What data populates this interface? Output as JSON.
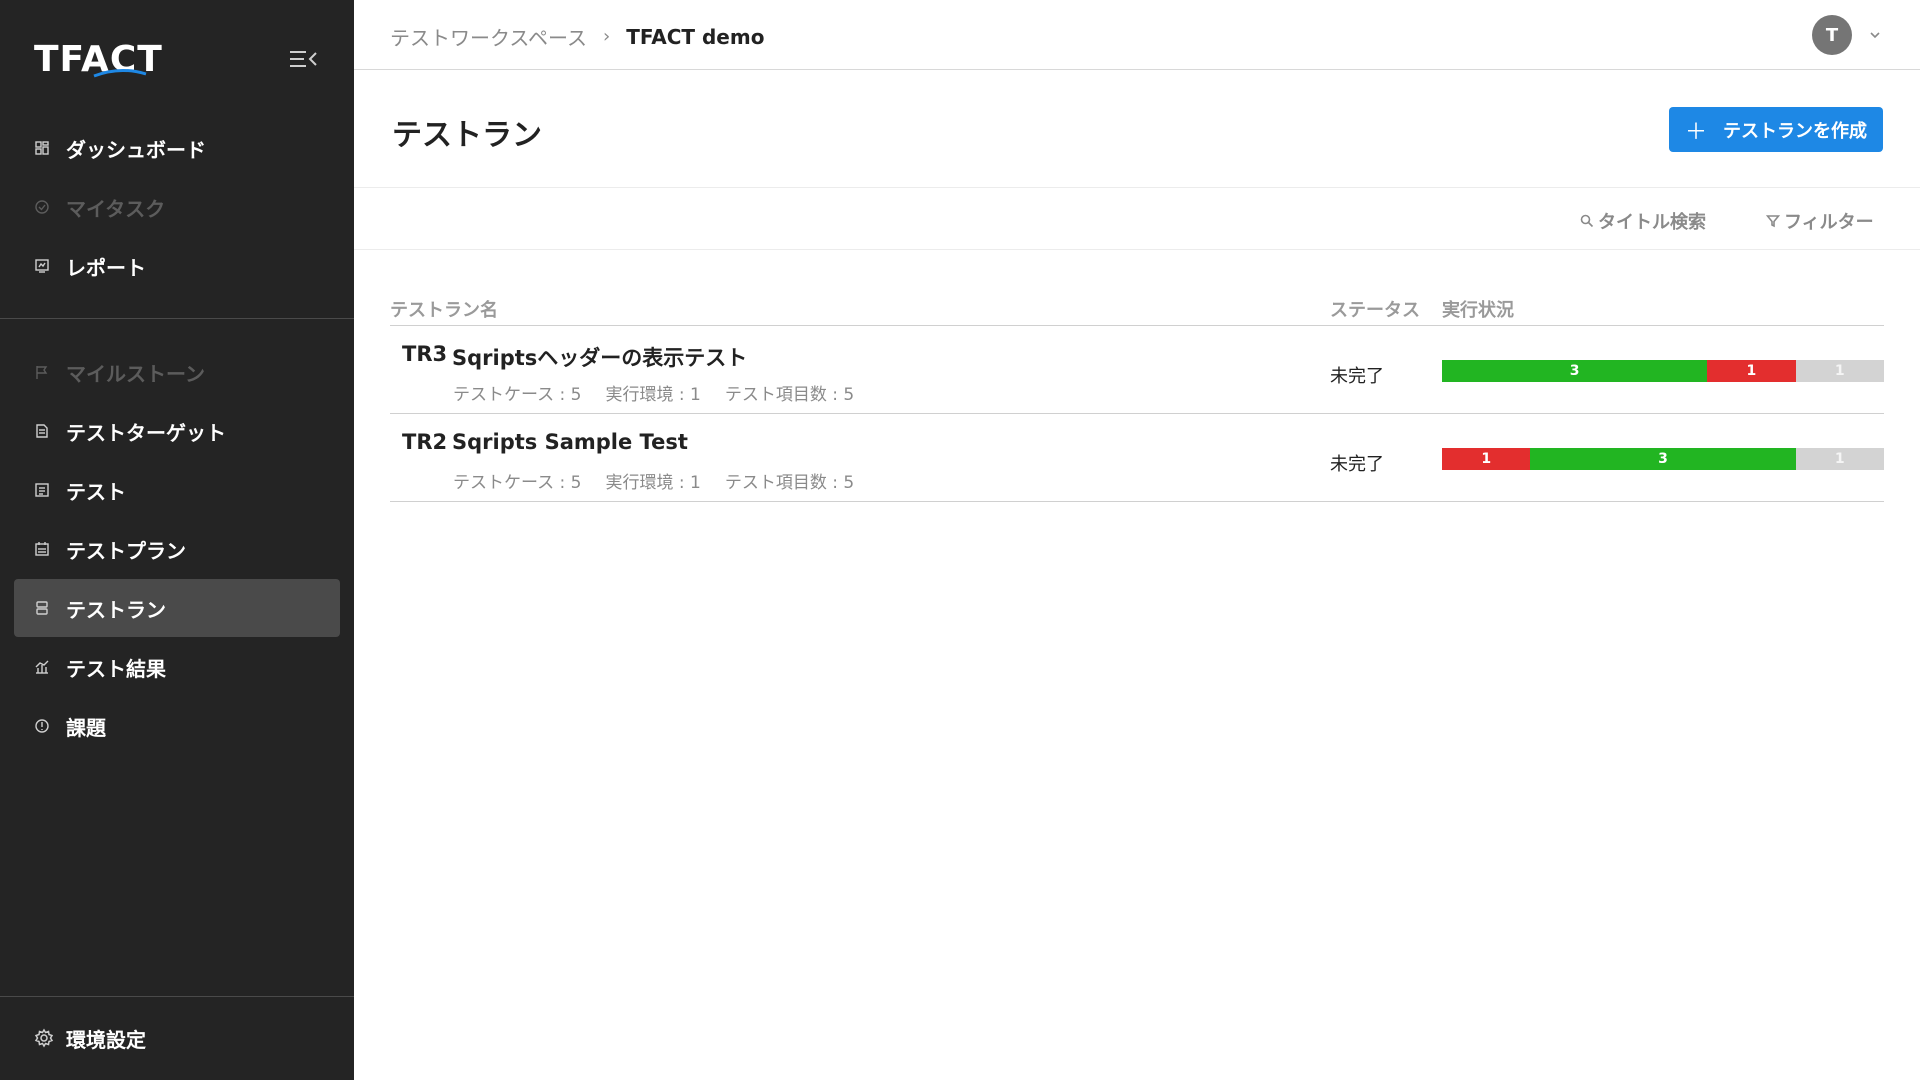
{
  "app": {
    "logo_text": "TFACT"
  },
  "sidebar": {
    "group1": [
      {
        "label": "ダッシュボード",
        "icon": "dashboard-icon",
        "disabled": false
      },
      {
        "label": "マイタスク",
        "icon": "check-circle-icon",
        "disabled": true
      },
      {
        "label": "レポート",
        "icon": "report-icon",
        "disabled": false
      }
    ],
    "group2": [
      {
        "label": "マイルストーン",
        "icon": "flag-icon",
        "disabled": true
      },
      {
        "label": "テストターゲット",
        "icon": "document-icon",
        "disabled": false
      },
      {
        "label": "テスト",
        "icon": "list-icon",
        "disabled": false
      },
      {
        "label": "テストプラン",
        "icon": "calendar-icon",
        "disabled": false
      },
      {
        "label": "テストラン",
        "icon": "database-icon",
        "disabled": false,
        "active": true
      },
      {
        "label": "テスト結果",
        "icon": "chart-icon",
        "disabled": false
      },
      {
        "label": "課題",
        "icon": "alert-icon",
        "disabled": false
      }
    ],
    "settings_label": "環境設定"
  },
  "header": {
    "breadcrumb_parent": "テストワークスペース",
    "breadcrumb_sep": "›",
    "breadcrumb_current": "TFACT demo",
    "avatar_initial": "T"
  },
  "page": {
    "title": "テストラン",
    "create_button_plus": "＋",
    "create_button_label": "テストランを作成"
  },
  "toolbar": {
    "search_label": "タイトル検索",
    "filter_label": "フィルター"
  },
  "table": {
    "headers": {
      "name": "テストラン名",
      "status": "ステータス",
      "progress": "実行状況"
    },
    "rows": [
      {
        "id": "TR3",
        "title": "Sqriptsヘッダーの表示テスト",
        "meta": [
          "テストケース : 5",
          "実行環境 : 1",
          "テスト項目数 : 5"
        ],
        "status": "未完了",
        "segments": [
          {
            "kind": "pass",
            "value": 3
          },
          {
            "kind": "fail",
            "value": 1
          },
          {
            "kind": "none",
            "value": 1
          }
        ]
      },
      {
        "id": "TR2",
        "title": "Sqripts Sample Test",
        "meta": [
          "テストケース : 5",
          "実行環境 : 1",
          "テスト項目数 : 5"
        ],
        "status": "未完了",
        "segments": [
          {
            "kind": "fail",
            "value": 1
          },
          {
            "kind": "pass",
            "value": 3
          },
          {
            "kind": "none",
            "value": 1
          }
        ]
      }
    ]
  },
  "colors": {
    "sidebar_bg": "#242424",
    "accent": "#1e88e5",
    "pass": "#22b522",
    "fail": "#e32e2e",
    "none": "#d3d3d3"
  }
}
